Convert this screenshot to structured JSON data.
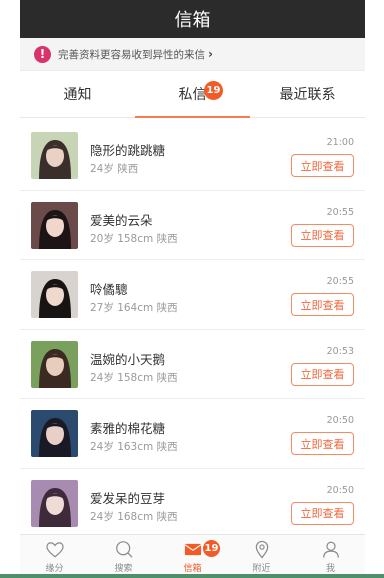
{
  "header": {
    "title": "信箱"
  },
  "notice": {
    "icon": "alert-circle-icon",
    "text": "完善资料更容易收到异性的来信",
    "chevron": "chevron-right-icon"
  },
  "tabs": [
    {
      "label": "通知",
      "active": false
    },
    {
      "label": "私信",
      "active": true,
      "badge": "19"
    },
    {
      "label": "最近联系",
      "active": false
    }
  ],
  "messages": [
    {
      "name": "隐形的跳跳糖",
      "meta": "24岁  陕西",
      "time": "21:00",
      "button": "立即查看",
      "avatar_colors": [
        "#c8d4b6",
        "#3a2f2a",
        "#e9d2c4"
      ]
    },
    {
      "name": "爱美的云朵",
      "meta": "20岁  158cm  陕西",
      "time": "20:55",
      "button": "立即查看",
      "avatar_colors": [
        "#6b4a4a",
        "#1d1515",
        "#f1d6cc"
      ]
    },
    {
      "name": "唥僪驄",
      "meta": "27岁  164cm  陕西",
      "time": "20:55",
      "button": "立即查看",
      "avatar_colors": [
        "#d9d3cf",
        "#171413",
        "#efd8cc"
      ]
    },
    {
      "name": "温婉的小天鹅",
      "meta": "24岁  158cm  陕西",
      "time": "20:53",
      "button": "立即查看",
      "avatar_colors": [
        "#7aa05e",
        "#3a2a22",
        "#e8cdbd"
      ]
    },
    {
      "name": "素雅的棉花糖",
      "meta": "24岁  163cm  陕西",
      "time": "20:50",
      "button": "立即查看",
      "avatar_colors": [
        "#2c4a6e",
        "#1a1a26",
        "#e8d0c8"
      ]
    },
    {
      "name": "爱发呆的豆芽",
      "meta": "24岁  168cm  陕西",
      "time": "20:50",
      "button": "立即查看",
      "avatar_colors": [
        "#a78bb0",
        "#3d2b3a",
        "#f0dcd6"
      ]
    }
  ],
  "tabbar": [
    {
      "label": "缘分",
      "icon": "heart-icon",
      "active": false
    },
    {
      "label": "搜索",
      "icon": "search-icon",
      "active": false
    },
    {
      "label": "信箱",
      "icon": "mail-icon",
      "active": true,
      "badge": "19"
    },
    {
      "label": "附近",
      "icon": "location-pin-icon",
      "active": false
    },
    {
      "label": "我",
      "icon": "user-icon",
      "active": false
    }
  ],
  "colors": {
    "accent": "#f25a27",
    "titlebar": "#2b2b2b",
    "alert": "#d8336a"
  }
}
